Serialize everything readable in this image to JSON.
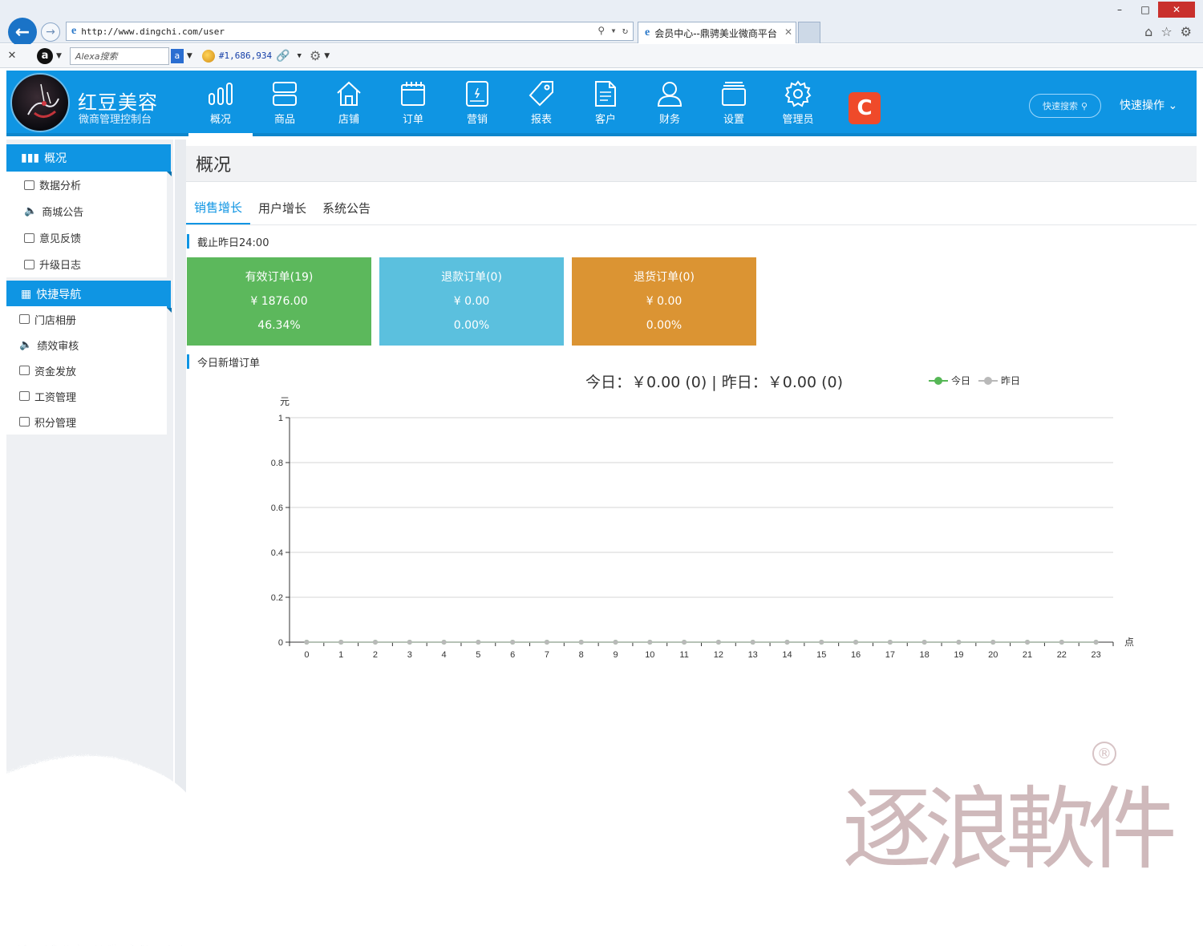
{
  "browser": {
    "url": "http://www.dingchi.com/user",
    "tab_title": "会员中心--鼎骋美业微商平台",
    "alexa_placeholder": "Alexa搜索",
    "alexa_rank": "#1,686,934"
  },
  "brand": {
    "name": "红豆美容",
    "subtitle": "微商管理控制台"
  },
  "nav": [
    {
      "label": "概况",
      "icon": "bar-chart-icon"
    },
    {
      "label": "商品",
      "icon": "product-icon"
    },
    {
      "label": "店铺",
      "icon": "home-icon"
    },
    {
      "label": "订单",
      "icon": "calendar-icon"
    },
    {
      "label": "营销",
      "icon": "tablet-icon"
    },
    {
      "label": "报表",
      "icon": "tag-icon"
    },
    {
      "label": "客户",
      "icon": "document-icon"
    },
    {
      "label": "财务",
      "icon": "user-icon"
    },
    {
      "label": "设置",
      "icon": "folder-icon"
    },
    {
      "label": "管理员",
      "icon": "gear-icon"
    }
  ],
  "header": {
    "quick_search": "快速搜索",
    "quick_ops": "快速操作"
  },
  "sidebar": {
    "group1_title": "概况",
    "group1_items": [
      "数据分析",
      "商城公告",
      "意见反馈",
      "升级日志"
    ],
    "group2_title": "快捷导航",
    "group2_items": [
      "门店相册",
      "绩效审核",
      "资金发放",
      "工资管理",
      "积分管理"
    ]
  },
  "main": {
    "page_title": "概况",
    "tabs": [
      "销售增长",
      "用户增长",
      "系统公告"
    ],
    "section_stats": "截止昨日24:00",
    "section_chart": "今日新增订单",
    "cards": [
      {
        "title": "有效订单(19)",
        "amount": "¥ 1876.00",
        "percent": "46.34%",
        "color": "#5cb85c"
      },
      {
        "title": "退款订单(0)",
        "amount": "¥ 0.00",
        "percent": "0.00%",
        "color": "#5bc0de"
      },
      {
        "title": "退货订单(0)",
        "amount": "¥ 0.00",
        "percent": "0.00%",
        "color": "#db9433"
      }
    ]
  },
  "chart_data": {
    "type": "line",
    "title": "今日：￥0.00 (0) | 昨日：￥0.00 (0)",
    "ylabel": "元",
    "xlabel": "点",
    "ylim": [
      0,
      1
    ],
    "y_ticks": [
      "0",
      "0.2",
      "0.4",
      "0.6",
      "0.8",
      "1"
    ],
    "x": [
      "0",
      "1",
      "2",
      "3",
      "4",
      "5",
      "6",
      "7",
      "8",
      "9",
      "10",
      "11",
      "12",
      "13",
      "14",
      "15",
      "16",
      "17",
      "18",
      "19",
      "20",
      "21",
      "22",
      "23"
    ],
    "series": [
      {
        "name": "今日",
        "color": "#56b756",
        "values": [
          0,
          0,
          0,
          0,
          0,
          0,
          0,
          0,
          0,
          0,
          0,
          0,
          0,
          0,
          0,
          0,
          0,
          0,
          0,
          0,
          0,
          0,
          0,
          0
        ]
      },
      {
        "name": "昨日",
        "color": "#b9b9b9",
        "values": [
          0,
          0,
          0,
          0,
          0,
          0,
          0,
          0,
          0,
          0,
          0,
          0,
          0,
          0,
          0,
          0,
          0,
          0,
          0,
          0,
          0,
          0,
          0,
          0
        ]
      }
    ],
    "legend": "top-right",
    "grid": true
  },
  "watermark": {
    "text": "逐浪軟件",
    "mark": "®"
  }
}
